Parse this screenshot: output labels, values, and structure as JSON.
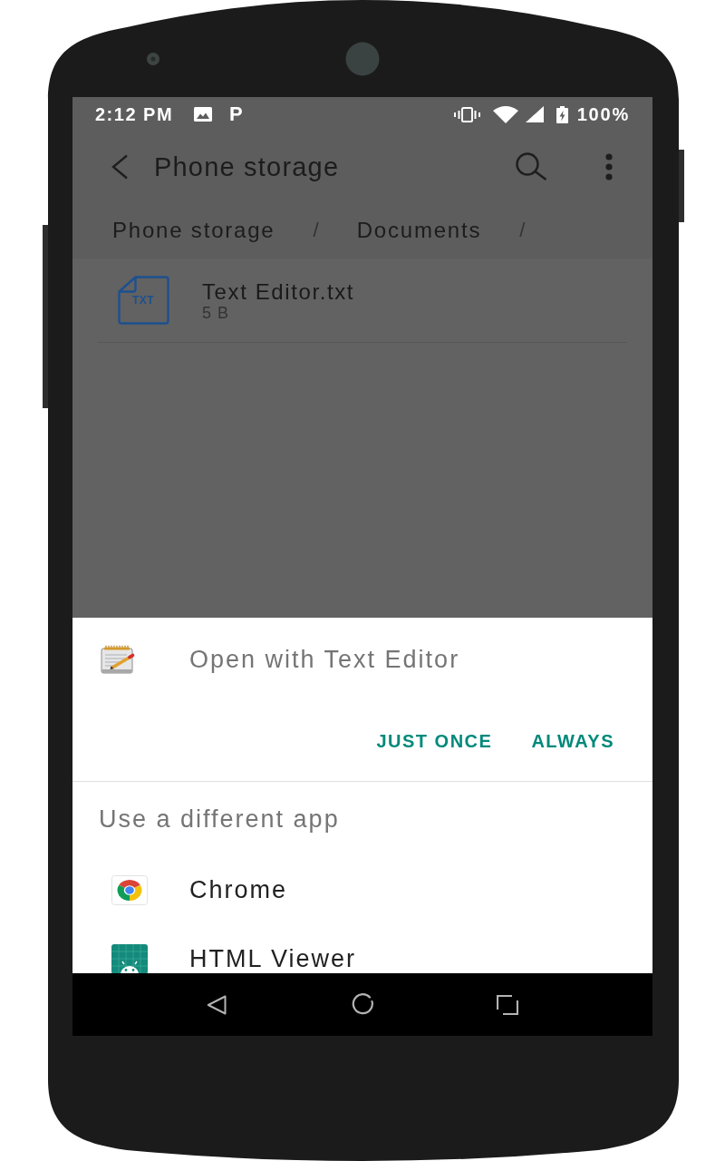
{
  "status_bar": {
    "time": "2:12 PM",
    "notification_glyph": "P",
    "battery": "100%"
  },
  "app_bar": {
    "title": "Phone storage"
  },
  "breadcrumbs": [
    {
      "label": "Phone storage",
      "separator": "/"
    },
    {
      "label": "Documents",
      "separator": "/"
    }
  ],
  "files": [
    {
      "name": "Text Editor.txt",
      "size": "5 B",
      "type_label": "TXT"
    }
  ],
  "dialog": {
    "title": "Open with Text Editor",
    "buttons": [
      {
        "label": "JUST ONCE"
      },
      {
        "label": "ALWAYS"
      }
    ],
    "section_title": "Use a different app",
    "apps": [
      {
        "name": "Chrome",
        "kind": "chrome"
      },
      {
        "name": "HTML Viewer",
        "kind": "android"
      }
    ]
  }
}
